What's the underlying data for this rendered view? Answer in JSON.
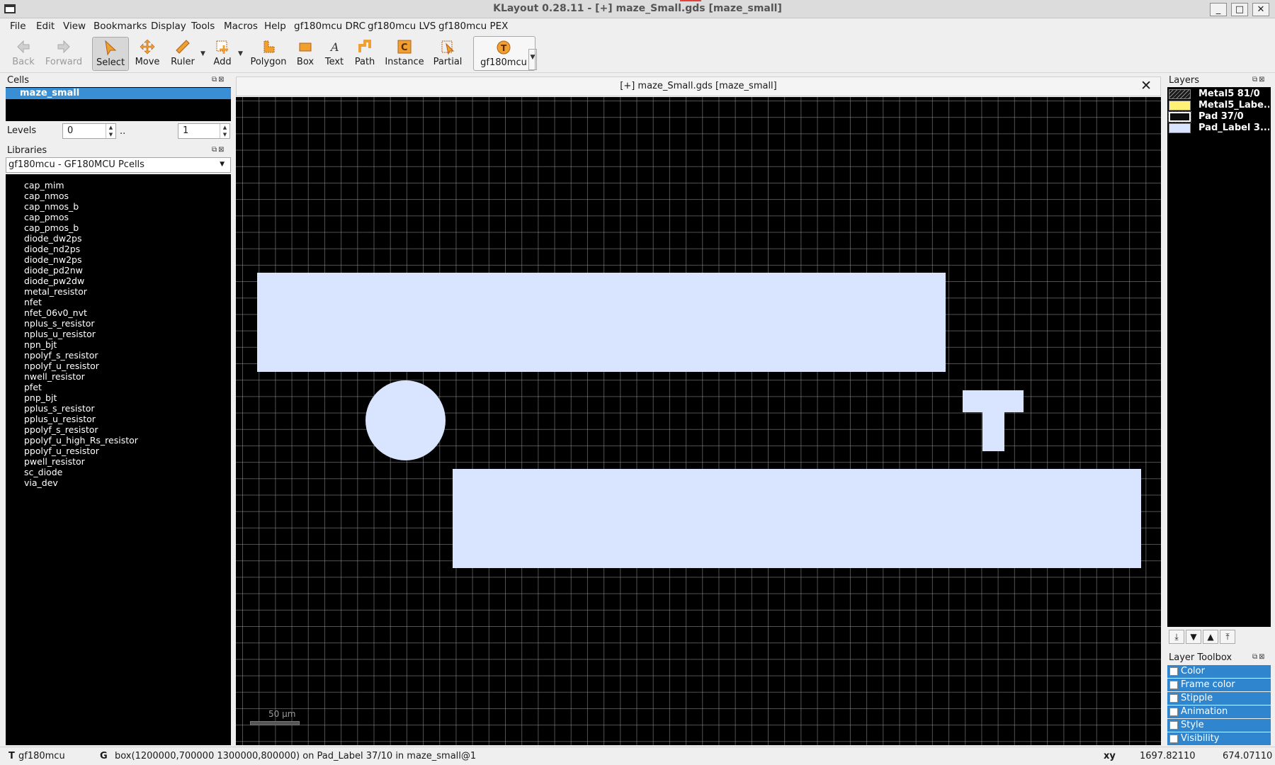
{
  "window": {
    "title": "KLayout 0.28.11 - [+] maze_Small.gds [maze_small]"
  },
  "menu": [
    "File",
    "Edit",
    "View",
    "Bookmarks",
    "Display",
    "Tools",
    "Macros",
    "Help",
    "gf180mcu DRC",
    "gf180mcu LVS",
    "gf180mcu PEX"
  ],
  "toolbar": {
    "back": "Back",
    "forward": "Forward",
    "select": "Select",
    "move": "Move",
    "ruler": "Ruler",
    "add": "Add",
    "polygon": "Polygon",
    "box": "Box",
    "text": "Text",
    "path": "Path",
    "instance": "Instance",
    "partial": "Partial",
    "tech": "gf180mcu"
  },
  "cells": {
    "header": "Cells",
    "selected": "maze_small",
    "levels_label": "Levels",
    "level_from": "0",
    "level_sep": "..",
    "level_to": "1"
  },
  "libraries": {
    "header": "Libraries",
    "selected": "gf180mcu - GF180MCU Pcells",
    "items": [
      "cap_mim",
      "cap_nmos",
      "cap_nmos_b",
      "cap_pmos",
      "cap_pmos_b",
      "diode_dw2ps",
      "diode_nd2ps",
      "diode_nw2ps",
      "diode_pd2nw",
      "diode_pw2dw",
      "metal_resistor",
      "nfet",
      "nfet_06v0_nvt",
      "nplus_s_resistor",
      "nplus_u_resistor",
      "npn_bjt",
      "npolyf_s_resistor",
      "npolyf_u_resistor",
      "nwell_resistor",
      "pfet",
      "pnp_bjt",
      "pplus_s_resistor",
      "pplus_u_resistor",
      "ppolyf_s_resistor",
      "ppolyf_u_high_Rs_resistor",
      "ppolyf_u_resistor",
      "pwell_resistor",
      "sc_diode",
      "via_dev"
    ]
  },
  "view": {
    "tab_title": "[+] maze_Small.gds [maze_small]",
    "scale": "50 µm"
  },
  "layers": {
    "header": "Layers",
    "items": [
      {
        "name": "Metal5 81/0",
        "color": "#1a1a1a"
      },
      {
        "name": "Metal5_Labe...",
        "color": "#fff176"
      },
      {
        "name": "Pad 37/0",
        "color": "#0d0d0d"
      },
      {
        "name": "Pad_Label 3...",
        "color": "#d9e5ff"
      }
    ]
  },
  "toolbox": {
    "header": "Layer Toolbox",
    "items": [
      "Color",
      "Frame color",
      "Stipple",
      "Animation",
      "Style",
      "Visibility"
    ]
  },
  "status": {
    "tech_key": "T",
    "tech": "gf180mcu",
    "grid_key": "G",
    "message": "box(1200000,700000 1300000,800000) on Pad_Label 37/10 in maze_small@1",
    "coord_key": "xy",
    "x": "1697.82110",
    "y": "674.07110"
  },
  "colors": {
    "selection": "#3a8fd4",
    "shape_fill": "#d9e5ff",
    "canvas": "#000000"
  }
}
